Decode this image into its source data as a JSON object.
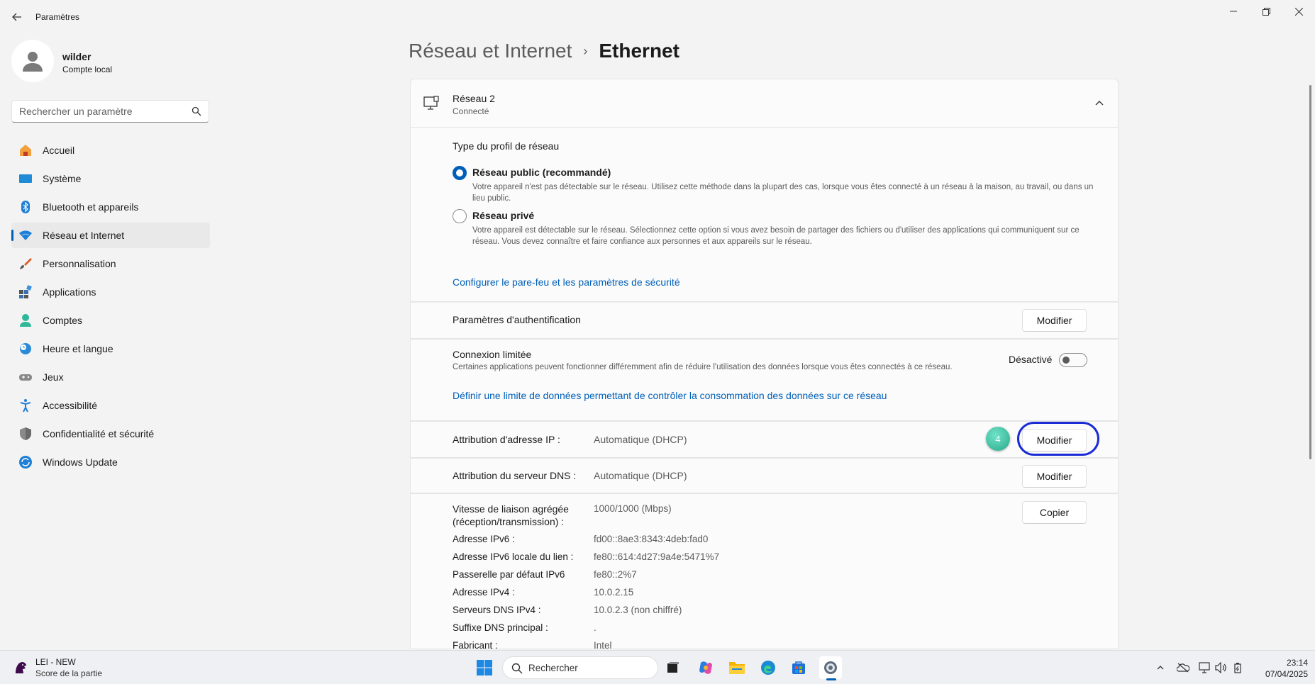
{
  "window": {
    "title": "Paramètres",
    "controls": {
      "minimize": "—",
      "maximize": "▢",
      "close": "✕"
    }
  },
  "user": {
    "name": "wilder",
    "account_type": "Compte local"
  },
  "search": {
    "placeholder": "Rechercher un paramètre"
  },
  "sidebar": {
    "items": [
      {
        "label": "Accueil",
        "icon": "home-icon"
      },
      {
        "label": "Système",
        "icon": "system-icon"
      },
      {
        "label": "Bluetooth et appareils",
        "icon": "bluetooth-icon"
      },
      {
        "label": "Réseau et Internet",
        "icon": "wifi-icon",
        "active": true
      },
      {
        "label": "Personnalisation",
        "icon": "brush-icon"
      },
      {
        "label": "Applications",
        "icon": "apps-icon"
      },
      {
        "label": "Comptes",
        "icon": "account-icon"
      },
      {
        "label": "Heure et langue",
        "icon": "clock-globe-icon"
      },
      {
        "label": "Jeux",
        "icon": "gamepad-icon"
      },
      {
        "label": "Accessibilité",
        "icon": "accessibility-icon"
      },
      {
        "label": "Confidentialité et sécurité",
        "icon": "shield-icon"
      },
      {
        "label": "Windows Update",
        "icon": "update-icon"
      }
    ]
  },
  "breadcrumb": {
    "parent": "Réseau et Internet",
    "separator": "›",
    "current": "Ethernet"
  },
  "network": {
    "name": "Réseau 2",
    "status": "Connecté"
  },
  "profile": {
    "title": "Type du profil de réseau",
    "public_label": "Réseau public (recommandé)",
    "public_desc": "Votre appareil n'est pas détectable sur le réseau. Utilisez cette méthode dans la plupart des cas, lorsque vous êtes connecté à un réseau à la maison, au travail, ou dans un lieu public.",
    "private_label": "Réseau privé",
    "private_desc": "Votre appareil est détectable sur le réseau. Sélectionnez cette option si vous avez besoin de partager des fichiers ou d'utiliser des applications qui communiquent sur ce réseau. Vous devez connaître et faire confiance aux personnes et aux appareils sur le réseau.",
    "selected": "public",
    "firewall_link": "Configurer le pare-feu et les paramètres de sécurité"
  },
  "auth": {
    "label": "Paramètres d'authentification",
    "button": "Modifier"
  },
  "metered": {
    "label": "Connexion limitée",
    "desc": "Certaines applications peuvent fonctionner différemment afin de réduire l'utilisation des données lorsque vous êtes connectés à ce réseau.",
    "state_label": "Désactivé",
    "on": false,
    "data_limit_link": "Définir une limite de données permettant de contrôler la consommation des données sur ce réseau"
  },
  "ip_assign": {
    "label": "Attribution d'adresse IP :",
    "value": "Automatique (DHCP)",
    "button": "Modifier",
    "step": "4"
  },
  "dns_assign": {
    "label": "Attribution du serveur DNS :",
    "value": "Automatique (DHCP)",
    "button": "Modifier"
  },
  "properties": {
    "copy_button": "Copier",
    "link_speed_label_1": "Vitesse de liaison agrégée",
    "link_speed_label_2": "(réception/transmission) :",
    "link_speed_value": "1000/1000 (Mbps)",
    "rows": [
      {
        "label": "Adresse IPv6 :",
        "value": "fd00::8ae3:8343:4deb:fad0"
      },
      {
        "label": "Adresse IPv6 locale du lien :",
        "value": "fe80::614:4d27:9a4e:5471%7"
      },
      {
        "label": "Passerelle par défaut IPv6",
        "value": "fe80::2%7"
      },
      {
        "label": "Adresse IPv4 :",
        "value": "10.0.2.15"
      },
      {
        "label": "Serveurs DNS IPv4 :",
        "value": "10.0.2.3 (non chiffré)"
      },
      {
        "label": "Suffixe DNS principal :",
        "value": "."
      },
      {
        "label": "Fabricant :",
        "value": "Intel"
      }
    ]
  },
  "taskbar": {
    "widget_title": "LEI - NEW",
    "widget_sub": "Score de la partie",
    "search_label": "Rechercher",
    "time": "23:14",
    "date": "07/04/2025"
  },
  "colors": {
    "accent": "#005fb8",
    "highlight": "#1a2bd6",
    "badge": "#2aa889"
  }
}
